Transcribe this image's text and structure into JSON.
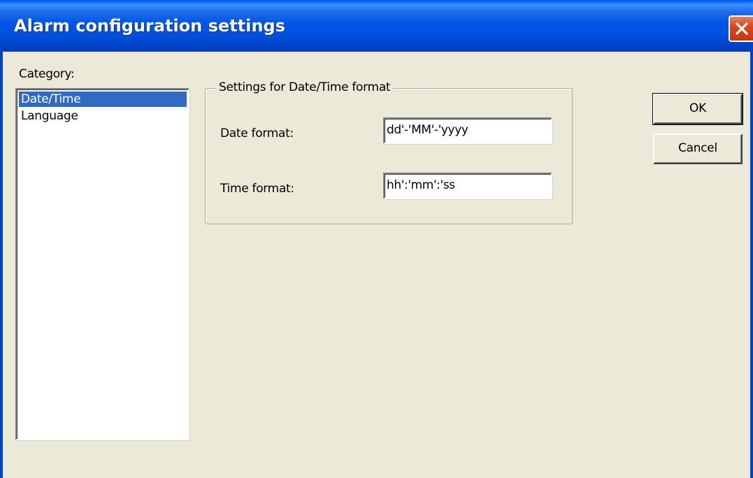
{
  "window": {
    "title": "Alarm configuration settings"
  },
  "category": {
    "label": "Category:",
    "items": [
      {
        "label": "Date/Time",
        "selected": true
      },
      {
        "label": "Language",
        "selected": false
      }
    ]
  },
  "settings": {
    "group_title": "Settings for Date/Time format",
    "date_format_label": "Date format:",
    "date_format_value": "dd'-'MM'-'yyyy",
    "time_format_label": "Time format:",
    "time_format_value": "hh':'mm':'ss"
  },
  "buttons": {
    "ok_label": "OK",
    "cancel_label": "Cancel"
  },
  "icons": {
    "close": "close-icon"
  },
  "colors": {
    "titlebar": "#0055e5",
    "selection": "#316ac5",
    "close_button": "#d8481c",
    "dialog_background": "#ece9d8"
  }
}
